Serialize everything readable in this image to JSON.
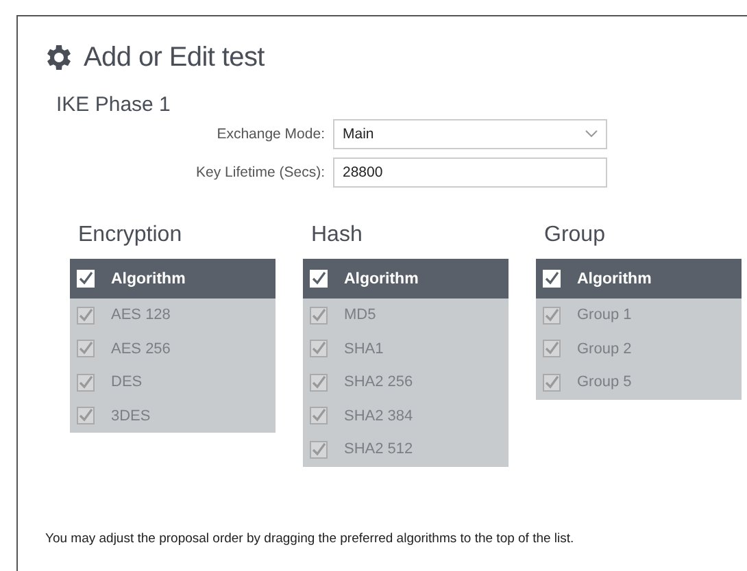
{
  "title": "Add or Edit test",
  "section": "IKE Phase 1",
  "fields": [
    {
      "kind": "select",
      "label": "Exchange Mode:",
      "value": "Main"
    },
    {
      "kind": "text",
      "label": "Key Lifetime (Secs):",
      "value": "28800"
    }
  ],
  "tables": [
    {
      "title": "Encryption",
      "header": {
        "label": "Algorithm",
        "checked": true
      },
      "rows": [
        {
          "label": "AES 128",
          "checked": true
        },
        {
          "label": "AES 256",
          "checked": true
        },
        {
          "label": "DES",
          "checked": true
        },
        {
          "label": "3DES",
          "checked": true
        }
      ]
    },
    {
      "title": "Hash",
      "header": {
        "label": "Algorithm",
        "checked": true
      },
      "rows": [
        {
          "label": "MD5",
          "checked": true
        },
        {
          "label": "SHA1",
          "checked": true
        },
        {
          "label": "SHA2 256",
          "checked": true
        },
        {
          "label": "SHA2 384",
          "checked": true
        },
        {
          "label": "SHA2 512",
          "checked": true
        }
      ]
    },
    {
      "title": "Group",
      "header": {
        "label": "Algorithm",
        "checked": true
      },
      "rows": [
        {
          "label": "Group 1",
          "checked": true
        },
        {
          "label": "Group 2",
          "checked": true
        },
        {
          "label": "Group 5",
          "checked": true
        }
      ]
    }
  ],
  "note": "You may adjust the proposal order by dragging the preferred algorithms to the top of the list."
}
